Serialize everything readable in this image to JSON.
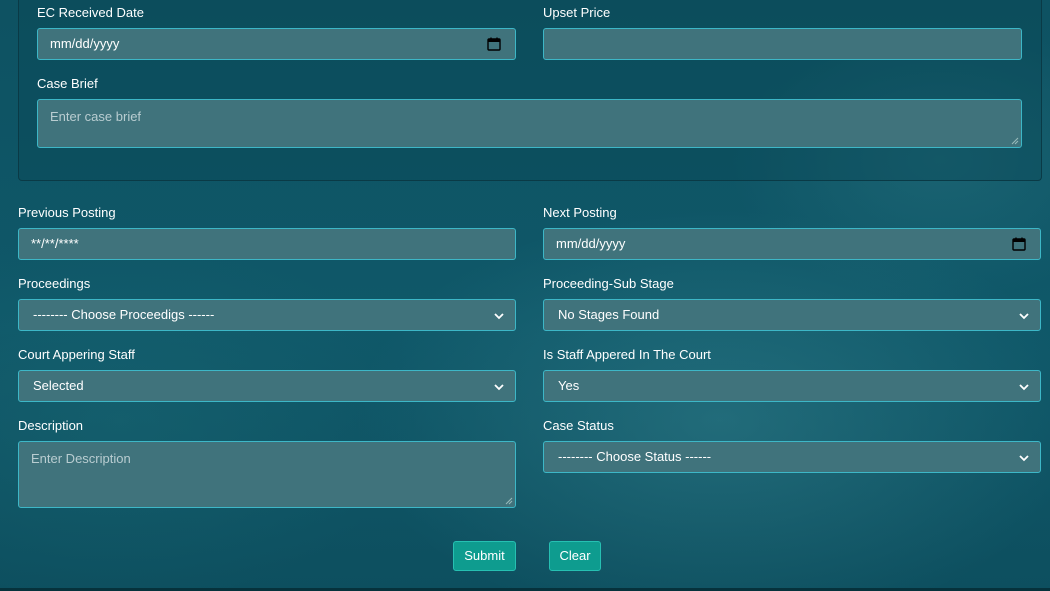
{
  "case_section": {
    "ec_received_date": {
      "label": "EC Received Date",
      "value": "mm/dd/yyyy"
    },
    "upset_price": {
      "label": "Upset Price",
      "value": ""
    },
    "case_brief": {
      "label": "Case Brief",
      "placeholder": "Enter case brief"
    }
  },
  "posting": {
    "previous_posting": {
      "label": "Previous Posting",
      "value": "**/**/****"
    },
    "next_posting": {
      "label": "Next Posting",
      "value": "mm/dd/yyyy"
    }
  },
  "proceedings": {
    "label": "Proceedings",
    "selected": "-------- Choose Proceedigs ------"
  },
  "proceeding_sub_stage": {
    "label": "Proceeding-Sub Stage",
    "selected": "No Stages Found"
  },
  "court_appearing_staff": {
    "label": "Court Appering Staff",
    "selected": "Selected"
  },
  "staff_appeared": {
    "label": "Is Staff Appered In The Court",
    "selected": "Yes"
  },
  "description": {
    "label": "Description",
    "placeholder": "Enter Description"
  },
  "case_status": {
    "label": "Case Status",
    "selected": "-------- Choose Status ------"
  },
  "actions": {
    "submit_label": "Submit",
    "clear_label": "Clear"
  },
  "icons": {
    "calendar": "calendar-icon",
    "dropdown": "chevron-down-icon",
    "resize": "resize-grip-icon"
  },
  "colors": {
    "background": "#0f5565",
    "field_fill": "#40737c",
    "field_border": "#3db7c7",
    "button": "#0e9c8f"
  }
}
